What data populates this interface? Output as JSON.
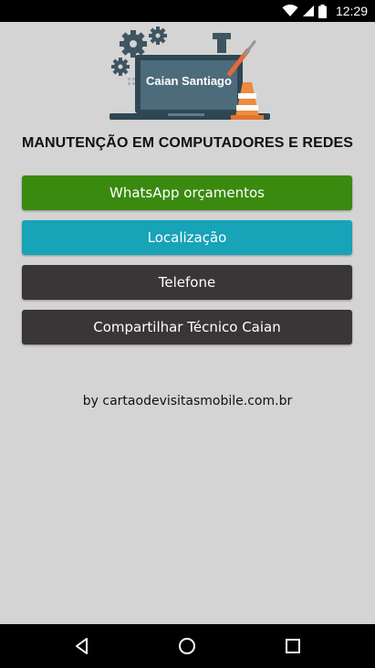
{
  "status_bar": {
    "time": "12:29",
    "icons": [
      "wifi-icon",
      "signal-icon",
      "battery-icon"
    ]
  },
  "logo": {
    "text": "Caian Santiago"
  },
  "headline": "MANUTENÇÃO EM COMPUTADORES E REDES",
  "buttons": {
    "whatsapp": {
      "label": "WhatsApp orçamentos",
      "color": "#3a8a10"
    },
    "location": {
      "label": "Localização",
      "color": "#17a3b8"
    },
    "phone": {
      "label": "Telefone",
      "color": "#3a3536"
    },
    "share": {
      "label": "Compartilhar Técnico Caian",
      "color": "#3a3536"
    }
  },
  "credit": "by cartaodevisitasmobile.com.br",
  "nav_bar": {
    "icons": [
      "back-icon",
      "home-icon",
      "recent-apps-icon"
    ]
  }
}
